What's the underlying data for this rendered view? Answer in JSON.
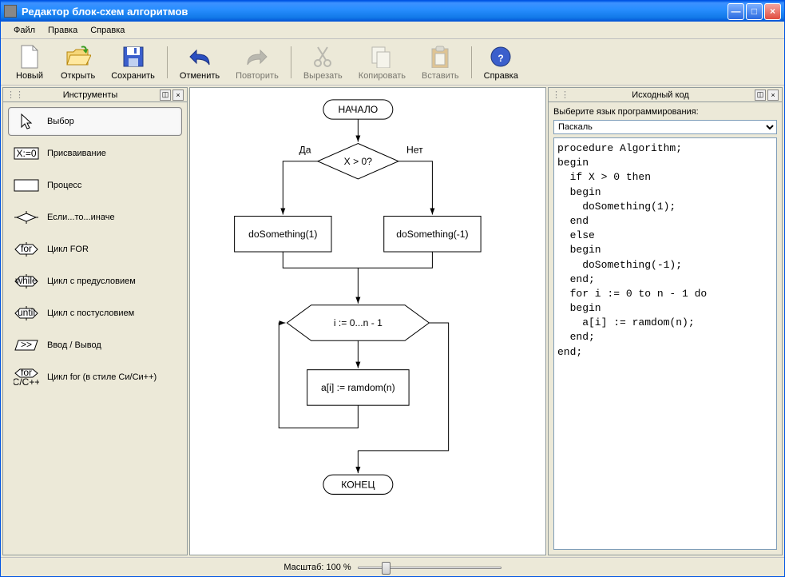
{
  "window": {
    "title": "Редактор блок-схем алгоритмов"
  },
  "menu": {
    "file": "Файл",
    "edit": "Правка",
    "help": "Справка"
  },
  "toolbar": {
    "new": "Новый",
    "open": "Открыть",
    "save": "Сохранить",
    "undo": "Отменить",
    "redo": "Повторить",
    "cut": "Вырезать",
    "copy": "Копировать",
    "paste": "Вставить",
    "help": "Справка"
  },
  "panels": {
    "tools_title": "Инструменты",
    "code_title": "Исходный код"
  },
  "tools": {
    "select": "Выбор",
    "assign": "Присваивание",
    "process": "Процесс",
    "ifelse": "Если...то...иначе",
    "for": "Цикл FOR",
    "while": "Цикл с предусловием",
    "until": "Цикл с постусловием",
    "io": "Ввод / Вывод",
    "forc": "Цикл for (в стиле Си/Си++)"
  },
  "flowchart": {
    "start": "НАЧАЛО",
    "cond": "X > 0?",
    "yes": "Да",
    "no": "Нет",
    "proc1": "doSomething(1)",
    "proc2": "doSomething(-1)",
    "loop": "i := 0...n - 1",
    "loopbody": "a[i] := ramdom(n)",
    "end": "КОНЕЦ"
  },
  "code": {
    "lang_label": "Выберите язык программирования:",
    "lang_selected": "Паскаль",
    "text": "procedure Algorithm;\nbegin\n  if X > 0 then\n  begin\n    doSomething(1);\n  end\n  else\n  begin\n    doSomething(-1);\n  end;\n  for i := 0 to n - 1 do\n  begin\n    a[i] := ramdom(n);\n  end;\nend;"
  },
  "status": {
    "zoom_label": "Масштаб: 100 %"
  }
}
